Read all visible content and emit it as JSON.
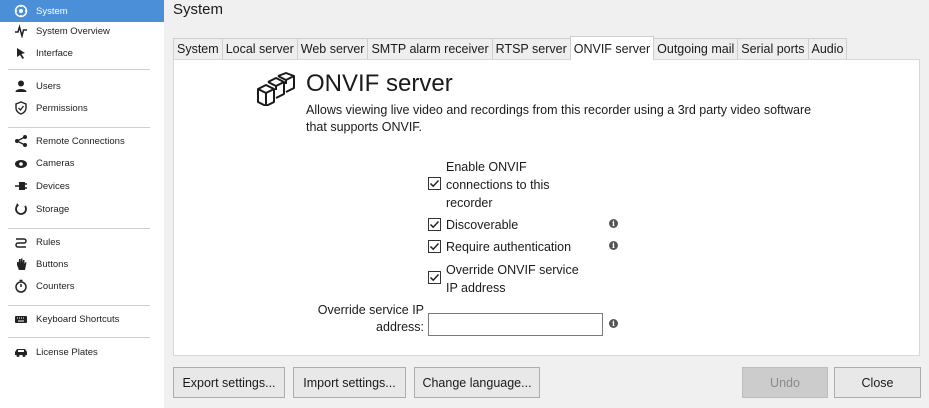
{
  "sidebar": {
    "items": [
      {
        "label": "System",
        "icon": "gear-icon",
        "active": true
      },
      {
        "label": "System Overview",
        "icon": "pulse-icon"
      },
      {
        "label": "Interface",
        "icon": "cursor-icon"
      },
      {
        "label": "Users",
        "icon": "user-icon"
      },
      {
        "label": "Permissions",
        "icon": "shield-icon"
      },
      {
        "label": "Remote Connections",
        "icon": "share-icon"
      },
      {
        "label": "Cameras",
        "icon": "camera-icon"
      },
      {
        "label": "Devices",
        "icon": "plug-icon"
      },
      {
        "label": "Storage",
        "icon": "storage-icon"
      },
      {
        "label": "Rules",
        "icon": "rules-icon"
      },
      {
        "label": "Buttons",
        "icon": "hand-icon"
      },
      {
        "label": "Counters",
        "icon": "counter-icon"
      },
      {
        "label": "Keyboard Shortcuts",
        "icon": "keyboard-icon"
      },
      {
        "label": "License Plates",
        "icon": "car-icon"
      }
    ]
  },
  "page": {
    "title": "System"
  },
  "tabs": [
    {
      "label": "System"
    },
    {
      "label": "Local server"
    },
    {
      "label": "Web server"
    },
    {
      "label": "SMTP alarm receiver"
    },
    {
      "label": "RTSP server"
    },
    {
      "label": "ONVIF server",
      "active": true
    },
    {
      "label": "Outgoing mail"
    },
    {
      "label": "Serial ports"
    },
    {
      "label": "Audio"
    }
  ],
  "onvif": {
    "title": "ONVIF server",
    "description": "Allows viewing live video and recordings from this recorder using a 3rd party video software that supports ONVIF.",
    "options": [
      {
        "label": "Enable ONVIF connections to this recorder",
        "checked": true
      },
      {
        "label": "Discoverable",
        "checked": true,
        "info": true
      },
      {
        "label": "Require authentication",
        "checked": true,
        "info": true
      },
      {
        "label": "Override ONVIF service IP address",
        "checked": true
      }
    ],
    "ip_label": "Override service IP address:",
    "ip_value": ""
  },
  "footer": {
    "export_label": "Export settings...",
    "import_label": "Import settings...",
    "language_label": "Change language...",
    "undo_label": "Undo",
    "close_label": "Close"
  },
  "colors": {
    "accent": "#4a8fd8",
    "disabled": "#cccccc"
  }
}
